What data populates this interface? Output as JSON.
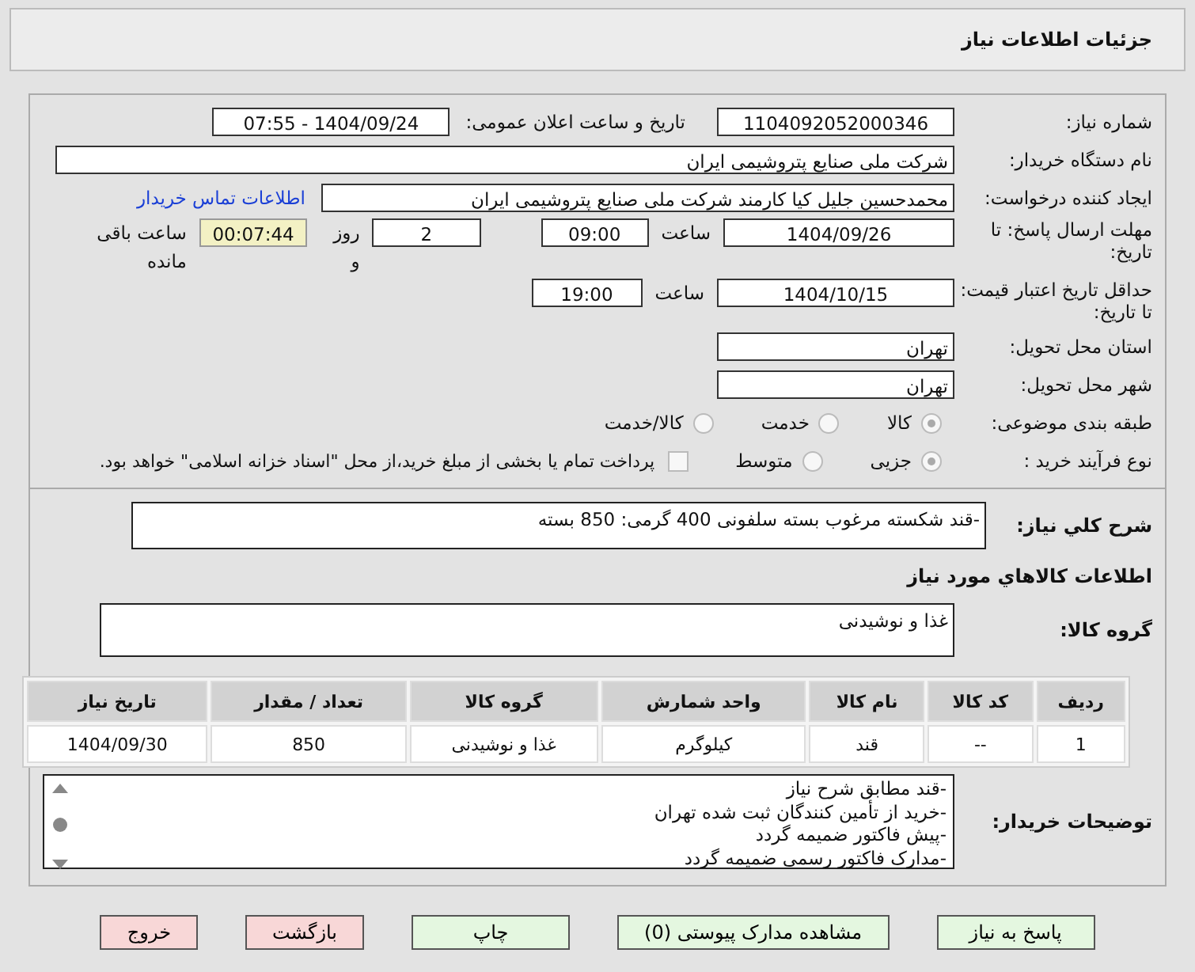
{
  "title": "جزئیات اطلاعات نیاز",
  "need_number": {
    "label": "شماره نیاز:",
    "value": "1104092052000346"
  },
  "announce": {
    "label": "تاریخ و ساعت اعلان عمومی:",
    "value": "1404/09/24 - 07:55"
  },
  "buyer": {
    "label": "نام دستگاه خریدار:",
    "value": "شرکت ملی صنایع پتروشیمی ایران"
  },
  "requester": {
    "label": "ایجاد کننده درخواست:",
    "value": "محمدحسین جلیل کیا کارمند شرکت ملی صنایع پتروشیمی ایران",
    "link": "اطلاعات تماس خریدار"
  },
  "deadline": {
    "label": "مهلت ارسال پاسخ: تا تاریخ:",
    "date": "1404/09/26",
    "time_label": "ساعت",
    "time": "09:00",
    "days": "2",
    "days_label": "روز و",
    "remaining": "00:07:44",
    "remaining_label": "ساعت باقی مانده"
  },
  "validity": {
    "label": "حداقل تاریخ اعتبار قیمت: تا تاریخ:",
    "date": "1404/10/15",
    "time_label": "ساعت",
    "time": "19:00"
  },
  "province": {
    "label": "استان محل تحویل:",
    "value": "تهران"
  },
  "city": {
    "label": "شهر محل تحویل:",
    "value": "تهران"
  },
  "category": {
    "label": "طبقه بندی موضوعی:",
    "options": [
      {
        "label": "کالا",
        "selected": true
      },
      {
        "label": "خدمت",
        "selected": false
      },
      {
        "label": "کالا/خدمت",
        "selected": false
      }
    ]
  },
  "process": {
    "label": "نوع فرآیند خرید :",
    "options": [
      {
        "label": "جزیی",
        "selected": true
      },
      {
        "label": "متوسط",
        "selected": false
      }
    ],
    "payment": {
      "checked": false,
      "label": "پرداخت تمام یا بخشی از مبلغ خرید،از محل \"اسناد خزانه اسلامی\" خواهد بود."
    }
  },
  "description": {
    "label": "شرح کلي نياز:",
    "value": "-قند شکسته مرغوب بسته سلفونی 400 گرمی: 850 بسته"
  },
  "goods_title": "اطلاعات کالاهاي مورد نياز",
  "goods_group": {
    "label": "گروه کالا:",
    "value": "غذا و نوشیدنی"
  },
  "table": {
    "columns": [
      "ردیف",
      "کد کالا",
      "نام کالا",
      "واحد شمارش",
      "گروه کالا",
      "تعداد / مقدار",
      "تاریخ نیاز"
    ],
    "rows": [
      [
        "1",
        "--",
        "قند",
        "کیلوگرم",
        "غذا و نوشیدنی",
        "850",
        "1404/09/30"
      ]
    ]
  },
  "notes": {
    "label": "توضیحات خریدار:",
    "lines": [
      "-قند مطابق شرح نیاز",
      "-خرید از تأمین کنندگان ثبت شده تهران",
      "-پیش فاکتور ضمیمه گردد",
      "-مدارک فاکتور رسمی ضمیمه گردد"
    ]
  },
  "buttons": [
    {
      "label": "پاسخ به نیاز",
      "kind": "green"
    },
    {
      "label": "مشاهده مدارک پیوستی (0)",
      "kind": "green"
    },
    {
      "label": "چاپ",
      "kind": "green"
    },
    {
      "label": "بازگشت",
      "kind": "red"
    },
    {
      "label": "خروج",
      "kind": "red"
    }
  ]
}
